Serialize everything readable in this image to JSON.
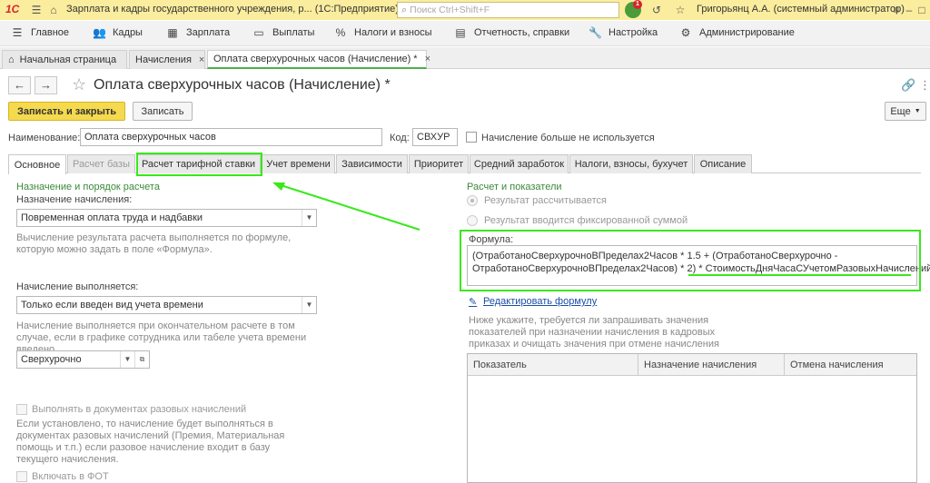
{
  "app": {
    "logo": "1С",
    "title": "Зарплата и кадры государственного учреждения, р... (1С:Предприятие)",
    "search_placeholder": "Поиск Ctrl+Shift+F",
    "notifications_count": "1",
    "user": "Григорьянц А.А. (системный администратор)"
  },
  "menu": [
    {
      "icon": "hamburger-icon",
      "label": "Главное"
    },
    {
      "icon": "people-icon",
      "label": "Кадры"
    },
    {
      "icon": "calculator-icon",
      "label": "Зарплата"
    },
    {
      "icon": "wallet-icon",
      "label": "Выплаты"
    },
    {
      "icon": "percent-icon",
      "label": "Налоги и взносы"
    },
    {
      "icon": "report-icon",
      "label": "Отчетность, справки"
    },
    {
      "icon": "wrench-icon",
      "label": "Настройка"
    },
    {
      "icon": "gear-icon",
      "label": "Администрирование"
    }
  ],
  "open_tabs": [
    {
      "label": "Начальная страница"
    },
    {
      "label": "Начисления"
    },
    {
      "label": "Оплата сверхурочных часов (Начисление) *"
    }
  ],
  "form": {
    "title": "Оплата сверхурочных часов (Начисление) *",
    "btn_save_close": "Записать и закрыть",
    "btn_save": "Записать",
    "btn_more": "Еще",
    "name_label": "Наименование:",
    "name_value": "Оплата сверхурочных часов",
    "code_label": "Код:",
    "code_value": "СВХУР",
    "not_used_label": "Начисление больше не используется"
  },
  "form_tabs": [
    {
      "label": "Основное",
      "state": "active"
    },
    {
      "label": "Расчет базы",
      "state": "disabled"
    },
    {
      "label": "Расчет тарифной ставки",
      "state": "normal"
    },
    {
      "label": "Учет времени",
      "state": "normal"
    },
    {
      "label": "Зависимости",
      "state": "normal"
    },
    {
      "label": "Приоритет",
      "state": "normal"
    },
    {
      "label": "Средний заработок",
      "state": "normal"
    },
    {
      "label": "Налоги, взносы, бухучет",
      "state": "normal"
    },
    {
      "label": "Описание",
      "state": "normal"
    }
  ],
  "left": {
    "section_title": "Назначение и порядок расчета",
    "purpose_label": "Назначение начисления:",
    "purpose_value": "Повременная оплата труда и надбавки",
    "purpose_hint": "Вычисление результата расчета выполняется по формуле, которую можно задать в поле «Формула».",
    "performed_label": "Начисление выполняется:",
    "performed_value": "Только если введен вид учета времени",
    "performed_hint": "Начисление выполняется при окончательном расчете в том случае, если в графике сотрудника или табеле учета времени введено",
    "time_type_value": "Сверхурочно",
    "one_time_docs_label": "Выполнять в документах разовых начислений",
    "one_time_docs_hint": "Если установлено, то начисление будет выполняться в документах разовых начислений (Премия, Материальная помощь и т.п.) если разовое начисление входит в базу текущего начисления.",
    "include_fot_label": "Включать в ФОТ"
  },
  "right": {
    "section_title": "Расчет и показатели",
    "radio_calc": "Результат рассчитывается",
    "radio_fixed": "Результат вводится фиксированной суммой",
    "formula_label": "Формула:",
    "formula_line1": "(ОтработаноСверхурочноВПределах2Часов * 1.5 + (ОтработаноСверхурочно -",
    "formula_line2a": "ОтработаноСверхурочноВПределах2Часов) * 2) * ",
    "formula_line2b": "СтоимостьДняЧасаСУчетомРазовыхНачислений",
    "edit_formula_link": "Редактировать формулу",
    "indicators_hint": "Ниже укажите, требуется ли запрашивать значения показателей при назначении начисления в кадровых приказах и очищать значения при отмене начисления",
    "table_headers": [
      "Показатель",
      "Назначение начисления",
      "Отмена начисления"
    ]
  },
  "colors": {
    "titlebar": "#fbed9e",
    "primary_button": "#f5d94e",
    "annotation_green": "#39e81b",
    "section_green": "#3a8a3a",
    "link_blue": "#1a4ea8"
  }
}
